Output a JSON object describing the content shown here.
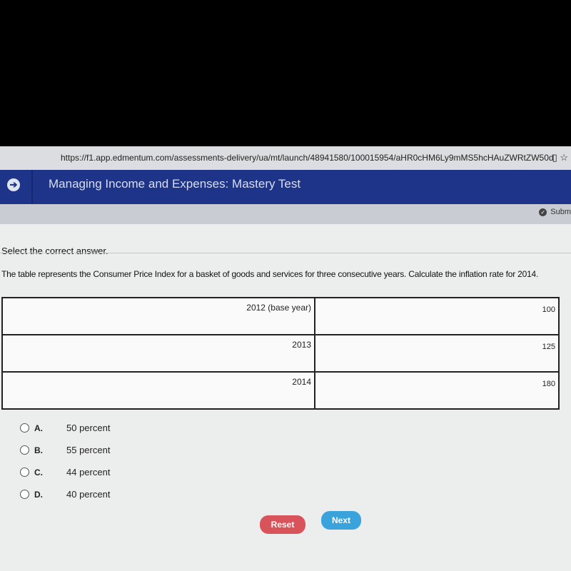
{
  "browser": {
    "url": "https://f1.app.edmentum.com/assessments-delivery/ua/mt/launch/48941580/100015954/aHR0cHM6Ly9mMS5hcHAuZWRtZW50d",
    "icons": [
      "reader-icon",
      "star-icon"
    ]
  },
  "header": {
    "title": "Managing Income and Expenses: Mastery Test",
    "back_icon": "arrow-right-circle-icon"
  },
  "toolbar": {
    "submit_label": "Subm"
  },
  "instruction": "Select the correct answer.",
  "question": "The table represents the Consumer Price Index for a basket of goods and services for three consecutive years. Calculate the inflation rate for 2014.",
  "table": {
    "rows": [
      {
        "year": "2012 (base year)",
        "cpi": "100"
      },
      {
        "year": "2013",
        "cpi": "125"
      },
      {
        "year": "2014",
        "cpi": "180"
      }
    ]
  },
  "options": [
    {
      "letter": "A.",
      "text": "50 percent"
    },
    {
      "letter": "B.",
      "text": "55 percent"
    },
    {
      "letter": "C.",
      "text": "44 percent"
    },
    {
      "letter": "D.",
      "text": "40 percent"
    }
  ],
  "buttons": {
    "reset": "Reset",
    "next": "Next"
  },
  "colors": {
    "header": "#1e3489",
    "reset": "#d9535a",
    "next": "#3aa3dc"
  }
}
